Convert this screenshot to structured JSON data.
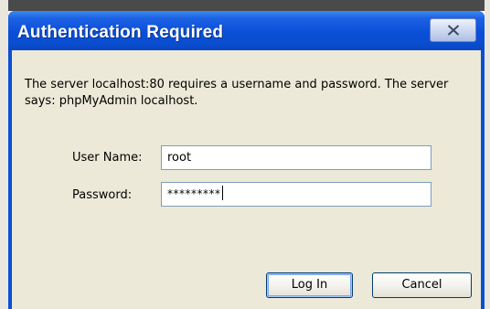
{
  "window": {
    "title": "Authentication Required",
    "close_symbol": "X"
  },
  "dialog": {
    "message": "The server localhost:80 requires a username and password. The server says: phpMyAdmin localhost."
  },
  "form": {
    "username_label": "User Name:",
    "username_value": "root",
    "password_label": "Password:",
    "password_value": "*********"
  },
  "buttons": {
    "login_label": "Log In",
    "cancel_label": "Cancel"
  },
  "icons": {
    "close": "close-icon"
  },
  "colors": {
    "titlebar": "#0a4fd6",
    "dialog_background": "#ece9d8",
    "button_border": "#003c74",
    "field_border": "#7f9db9"
  }
}
